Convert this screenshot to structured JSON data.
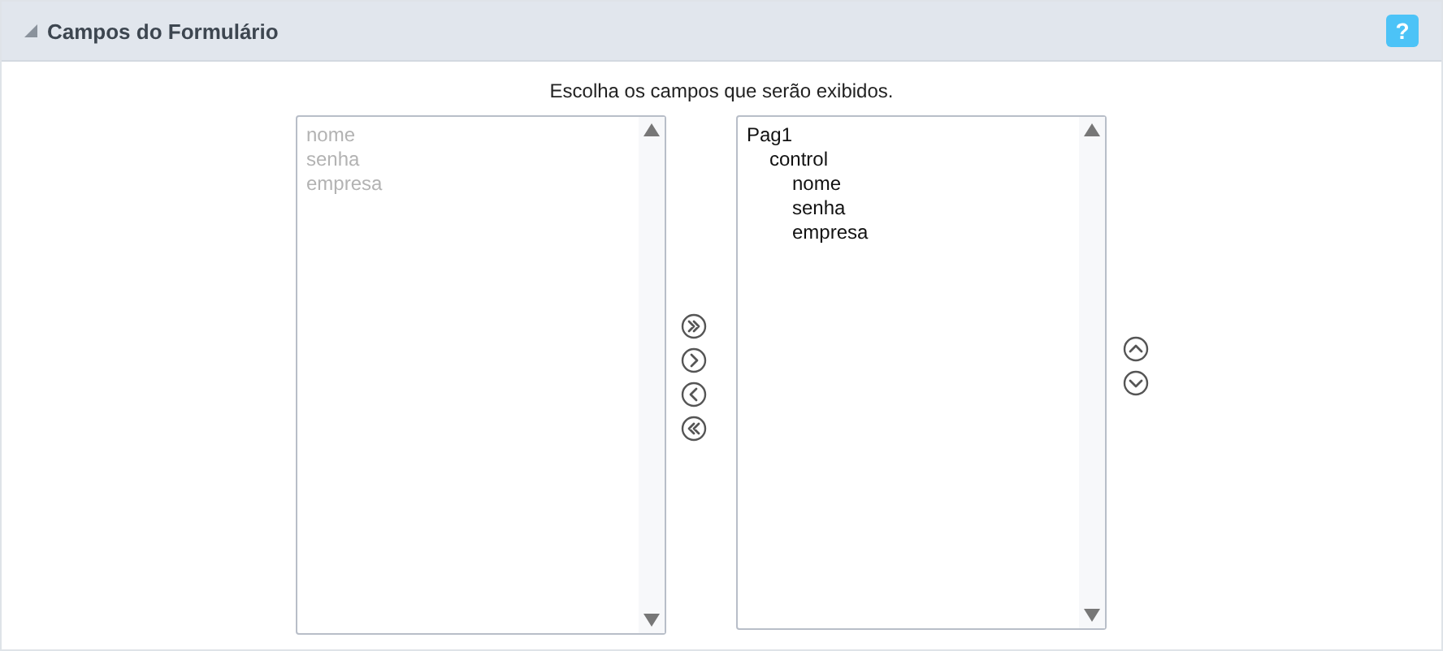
{
  "panel": {
    "title": "Campos do Formulário",
    "help_label": "?",
    "instruction": "Escolha os campos que serão exibidos."
  },
  "available_fields": [
    {
      "label": "nome",
      "disabled": true
    },
    {
      "label": "senha",
      "disabled": true
    },
    {
      "label": "empresa",
      "disabled": true
    }
  ],
  "selected_fields": [
    {
      "label": "Pag1",
      "children": [
        {
          "label": "control",
          "children": [
            {
              "label": "nome"
            },
            {
              "label": "senha"
            },
            {
              "label": "empresa"
            }
          ]
        }
      ]
    }
  ]
}
